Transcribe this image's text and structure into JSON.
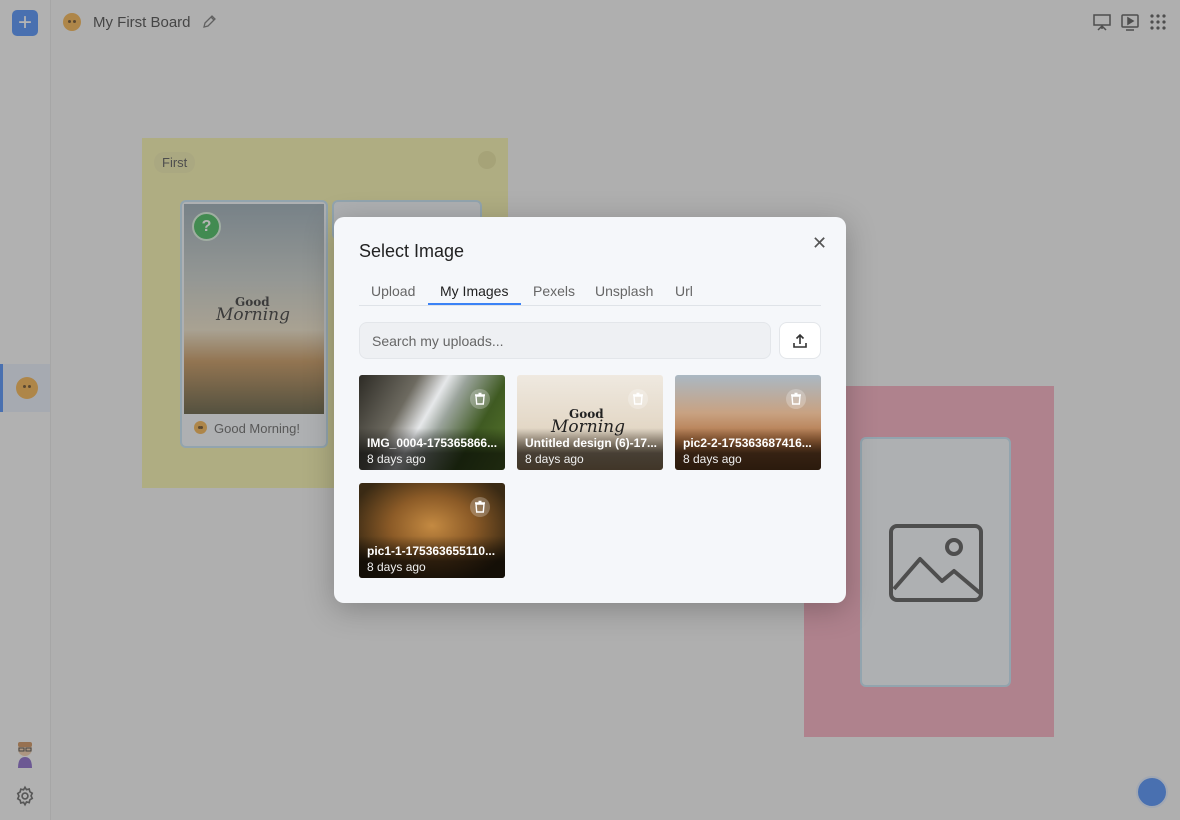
{
  "header": {
    "board_title": "My First Board"
  },
  "sidebar": {
    "add_icon": "plus-icon",
    "board_icon": "emoji-face-icon",
    "settings_icon": "gear-icon"
  },
  "board": {
    "section_first_label": "First",
    "card_caption": "Good Morning!",
    "card_text_line1": "Good",
    "card_text_line2": "Morning"
  },
  "modal": {
    "title": "Select Image",
    "tabs": [
      {
        "label": "Upload"
      },
      {
        "label": "My Images"
      },
      {
        "label": "Pexels"
      },
      {
        "label": "Unsplash"
      },
      {
        "label": "Url"
      }
    ],
    "active_tab": "My Images",
    "search_placeholder": "Search my uploads...",
    "images": [
      {
        "name": "IMG_0004-175365866...",
        "date": "8 days ago"
      },
      {
        "name": "Untitled design (6)-17...",
        "date": "8 days ago"
      },
      {
        "name": "pic2-2-175363687416...",
        "date": "8 days ago"
      },
      {
        "name": "pic1-1-175363655110...",
        "date": "8 days ago"
      }
    ],
    "tile2_text_line1": "Good",
    "tile2_text_line2": "Morning"
  },
  "colors": {
    "accent": "#3b82f6",
    "section_yellow": "#f5f0a3",
    "section_pink": "#f5a3b7"
  }
}
